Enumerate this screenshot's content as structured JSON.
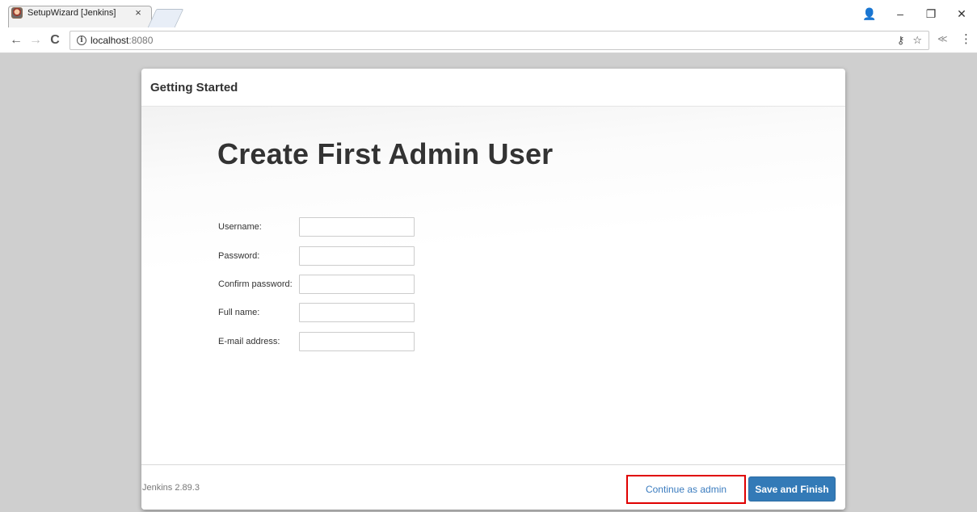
{
  "browser": {
    "tab_title": "SetupWizard [Jenkins]",
    "tab_close": "×",
    "url_host": "localhost",
    "url_port": ":8080",
    "nav": {
      "back": "←",
      "forward": "→",
      "reload": "C"
    },
    "window_controls": {
      "profile": "👤",
      "minimize": "–",
      "restore": "❐",
      "close": "✕"
    },
    "omnibox_icons": {
      "key": "⚷",
      "star": "☆"
    },
    "extension": "≪",
    "menu": "⋮"
  },
  "dialog": {
    "header": "Getting Started",
    "title": "Create First Admin User",
    "fields": [
      {
        "label": "Username:",
        "value": ""
      },
      {
        "label": "Password:",
        "value": ""
      },
      {
        "label": "Confirm password:",
        "value": ""
      },
      {
        "label": "Full name:",
        "value": ""
      },
      {
        "label": "E-mail address:",
        "value": ""
      }
    ],
    "footer": {
      "version": "Jenkins 2.89.3",
      "continue_label": "Continue as admin",
      "save_label": "Save and Finish"
    }
  },
  "colors": {
    "primary_button": "#337ab7",
    "link": "#3b7cbf",
    "highlight_box": "#e00000",
    "page_background": "#cfcfcf"
  }
}
